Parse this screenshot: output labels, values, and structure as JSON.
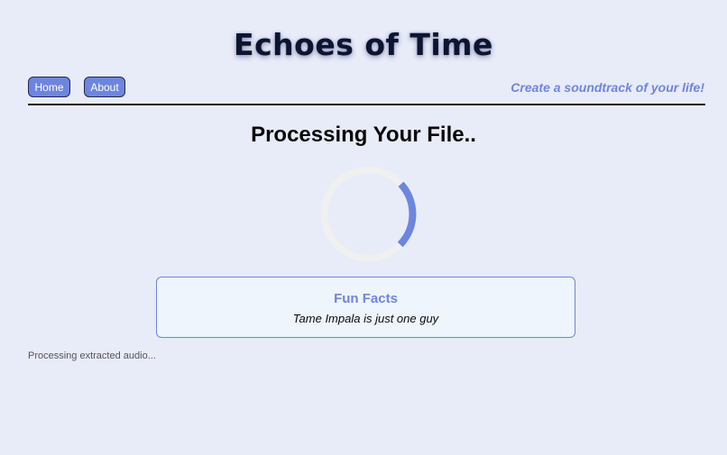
{
  "header": {
    "title": "Echoes of Time",
    "tagline": "Create a soundtrack of your life!"
  },
  "nav": {
    "home_label": "Home",
    "about_label": "About"
  },
  "main": {
    "heading": "Processing Your File..",
    "spinner": {
      "icon": "loading-spinner-icon",
      "track_color": "#f0f0f0",
      "arc_color": "#6d86dd"
    },
    "fun_facts": {
      "title": "Fun Facts",
      "text": "Tame Impala is just one guy"
    },
    "status_text": "Processing extracted audio..."
  },
  "colors": {
    "background": "#e8ebf8",
    "accent": "#6d86dd",
    "title": "#0b1530"
  }
}
